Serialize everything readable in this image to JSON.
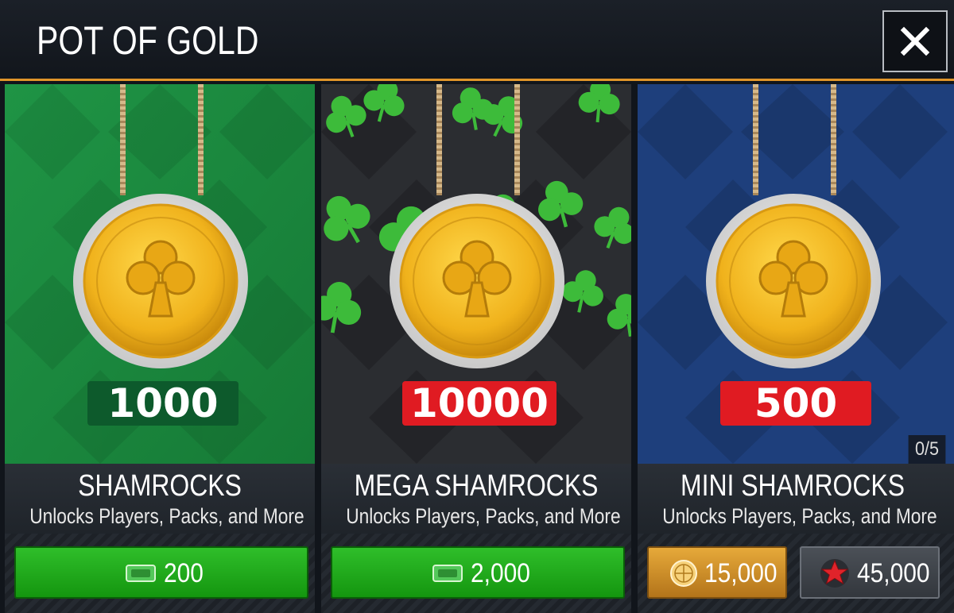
{
  "dialog": {
    "title": "POT OF GOLD",
    "close_label": "✕"
  },
  "cards": [
    {
      "amount": "1000",
      "badge_color": "#0d5a2c",
      "theme_color": "#1b8a3e",
      "name": "SHAMROCKS",
      "description": "Unlocks Players, Packs, and More",
      "prices": [
        {
          "currency": "nba-live-cash",
          "icon": "cash-icon",
          "value": "200"
        }
      ]
    },
    {
      "amount": "10000",
      "badge_color": "#e01b22",
      "theme_color": "#2b2d31",
      "name": "MEGA SHAMROCKS",
      "description": "Unlocks Players, Packs, and More",
      "prices": [
        {
          "currency": "nba-live-cash",
          "icon": "cash-icon",
          "value": "2,000"
        }
      ]
    },
    {
      "amount": "500",
      "badge_color": "#e01b22",
      "theme_color": "#1e3f7c",
      "name": "MINI SHAMROCKS",
      "description": "Unlocks Players, Packs, and More",
      "progress": "0/5",
      "prices": [
        {
          "currency": "coins",
          "icon": "basketball-coin-icon",
          "value": "15,000"
        },
        {
          "currency": "stars",
          "icon": "red-star-icon",
          "value": "45,000"
        }
      ]
    }
  ],
  "colors": {
    "accent_orange": "#e0952a",
    "buy_green": "#1fa61a",
    "coin_gold": "#f2b823"
  }
}
